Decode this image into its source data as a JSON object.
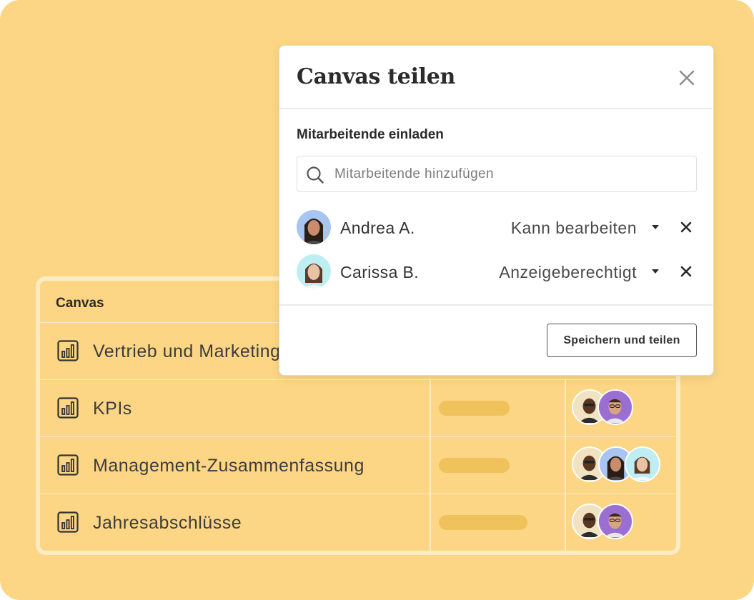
{
  "table": {
    "header": "Canvas",
    "rows": [
      {
        "name": "Vertrieb und Marketing",
        "icon": "chart-icon"
      },
      {
        "name": "KPIs",
        "icon": "chart-icon"
      },
      {
        "name": "Management-Zusammenfassung",
        "icon": "chart-icon"
      },
      {
        "name": "Jahresabschlüsse",
        "icon": "chart-icon"
      }
    ]
  },
  "modal": {
    "title": "Canvas teilen",
    "section_label": "Mitarbeitende einladen",
    "search": {
      "placeholder": "Mitarbeitende hinzufügen",
      "value": ""
    },
    "members": [
      {
        "name": "Andrea A.",
        "permission": "Kann bearbeiten"
      },
      {
        "name": "Carissa B.",
        "permission": "Anzeigeberechtigt"
      }
    ],
    "save_label": "Speichern und teilen"
  },
  "colors": {
    "background": "#fcd585",
    "pill": "#efc25c",
    "accent_purple": "#9b6fd1"
  }
}
